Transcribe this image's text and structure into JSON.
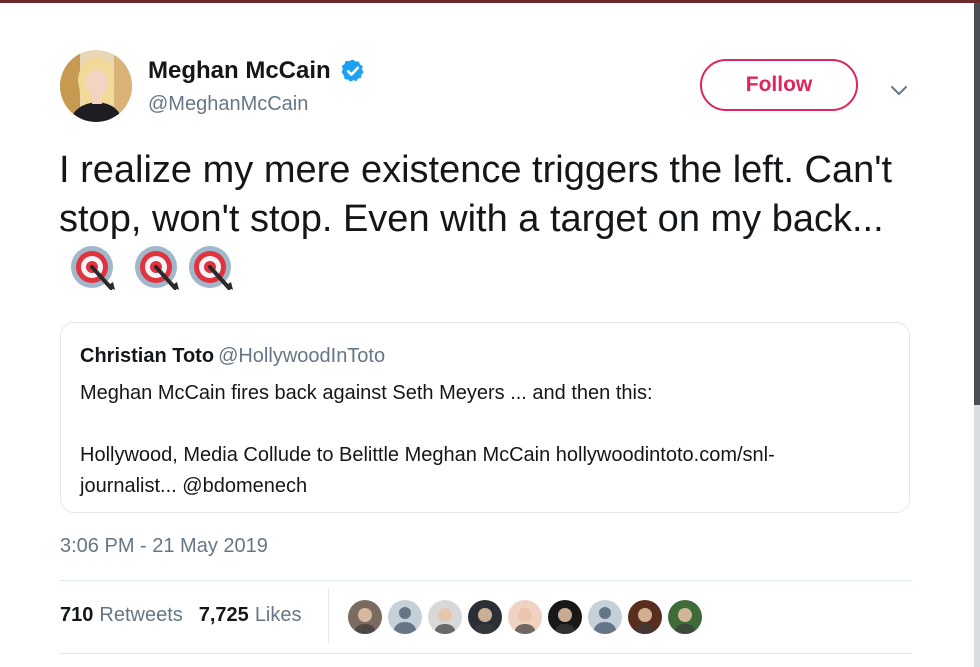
{
  "author": {
    "name": "Meghan McCain",
    "handle": "@MeghanMcCain",
    "verified": true,
    "avatar_icon": "profile-avatar"
  },
  "follow_label": "Follow",
  "menu_icon": "chevron-down-icon",
  "tweet": {
    "text": "I realize my mere existence triggers the left. Can't stop, won't stop. Even with a target on my back...",
    "emoji": [
      "direct-hit-icon",
      "direct-hit-icon",
      "direct-hit-icon"
    ]
  },
  "quoted": {
    "name": "Christian Toto",
    "handle": "@HollywoodInToto",
    "line1": "Meghan McCain fires back against Seth Meyers ... and then this:",
    "line2": "Hollywood, Media Collude to Belittle Meghan McCain hollywoodintoto.com/snl-",
    "line3": "journalist... @bdomenech"
  },
  "timestamp": "3:06 PM - 21 May 2019",
  "stats": {
    "retweets_count": "710",
    "retweets_label": "Retweets",
    "likes_count": "7,725",
    "likes_label": "Likes"
  },
  "likers": [
    {
      "icon": "liker-avatar-1",
      "color": "#7a6a60"
    },
    {
      "icon": "default-avatar",
      "color": "#c5d0d8"
    },
    {
      "icon": "liker-avatar-3",
      "color": "#d8d8d8"
    },
    {
      "icon": "liker-avatar-4",
      "color": "#2b2f36"
    },
    {
      "icon": "liker-avatar-5",
      "color": "#f0d2c2"
    },
    {
      "icon": "liker-avatar-6",
      "color": "#181818"
    },
    {
      "icon": "default-avatar",
      "color": "#c5d0d8"
    },
    {
      "icon": "liker-avatar-8",
      "color": "#5a2e1e"
    },
    {
      "icon": "liker-avatar-9",
      "color": "#3f6b3a"
    }
  ],
  "colors": {
    "follow_accent": "#e0245e",
    "verified_blue": "#1da1f2",
    "secondary_text": "#657786",
    "primary_text": "#14171a"
  }
}
